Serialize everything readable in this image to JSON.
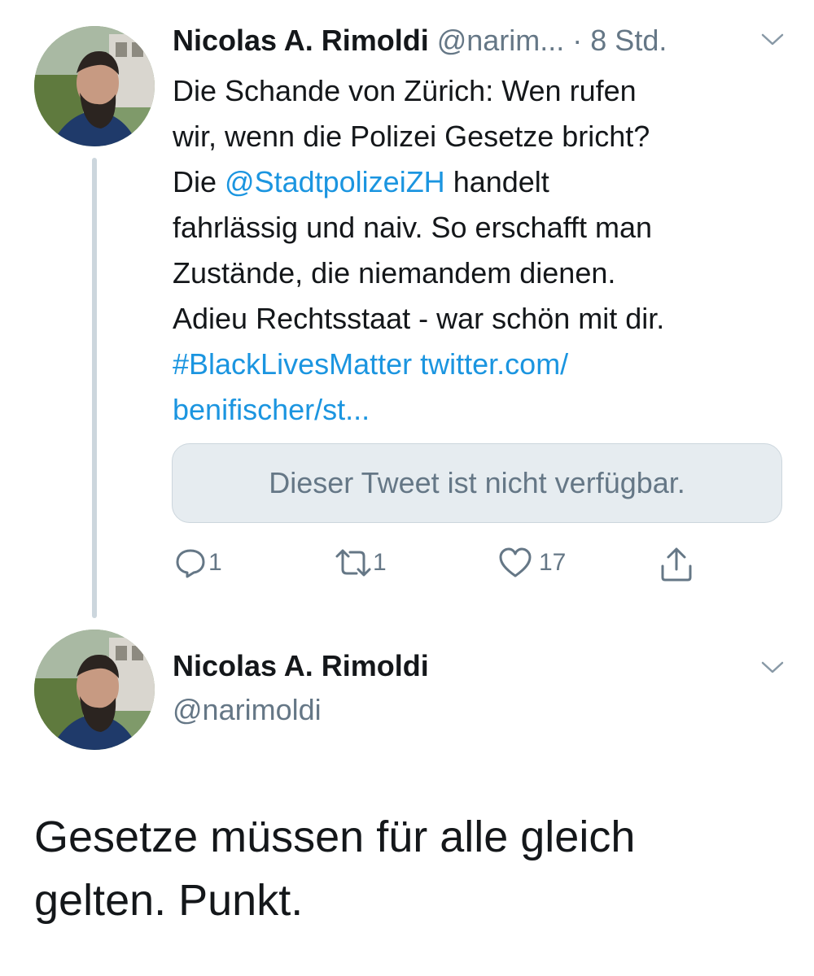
{
  "tweet1": {
    "name": "Nicolas A. Rimoldi",
    "handle": "@narim...",
    "time": "· 8 Std.",
    "lines": [
      [
        {
          "t": "Die Schande von Zürich: Wen rufen"
        }
      ],
      [
        {
          "t": "wir, wenn die Polizei Gesetze bricht?"
        }
      ],
      [
        {
          "t": "Die "
        },
        {
          "t": "@StadtpolizeiZH",
          "link": true
        },
        {
          "t": " handelt"
        }
      ],
      [
        {
          "t": "fahrlässig und naiv. So erschafft man"
        }
      ],
      [
        {
          "t": "Zustände, die niemandem dienen."
        }
      ],
      [
        {
          "t": "Adieu Rechtsstaat - war schön mit dir."
        }
      ],
      [
        {
          "t": "#BlackLivesMatter",
          "link": true
        },
        {
          "t": " "
        },
        {
          "t": "twitter.com/",
          "link": true
        }
      ],
      [
        {
          "t": "benifischer/st...",
          "link": true
        }
      ]
    ],
    "quoted_unavailable": "Dieser Tweet ist nicht verfügbar.",
    "actions": {
      "reply_count": "1",
      "retweet_count": "1",
      "like_count": "17"
    }
  },
  "tweet2": {
    "name": "Nicolas A. Rimoldi",
    "handle": "@narimoldi",
    "text_lines": [
      "Gesetze müssen für alle gleich",
      "gelten. Punkt."
    ]
  },
  "colors": {
    "link": "#1b95e0",
    "secondary": "#657786",
    "text": "#14171a",
    "thread_line": "#ccd6dd"
  },
  "icons": [
    "reply-icon",
    "retweet-icon",
    "like-icon",
    "share-icon",
    "chevron-down-icon"
  ]
}
